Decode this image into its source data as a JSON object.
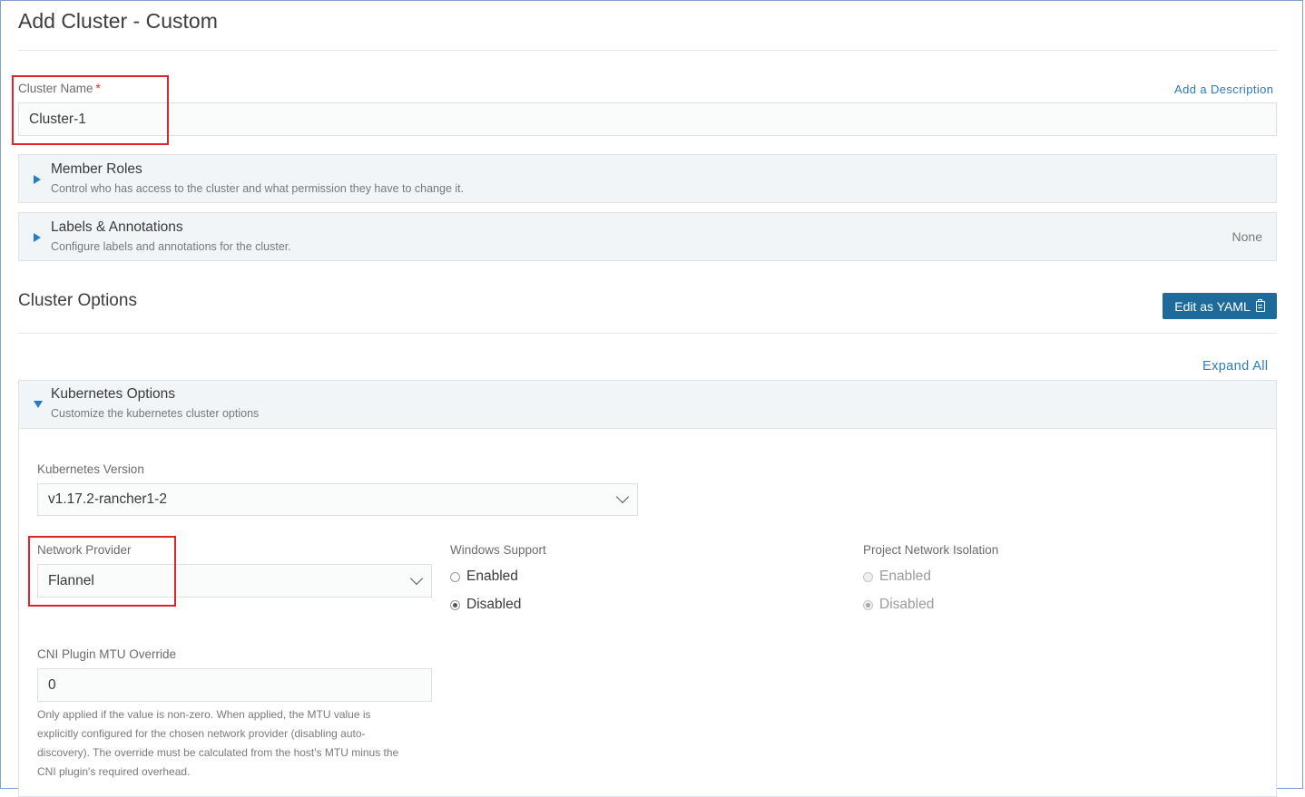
{
  "header": {
    "title": "Add Cluster - Custom"
  },
  "cluster_name": {
    "label": "Cluster Name",
    "required_marker": "*",
    "value": "Cluster-1",
    "add_description_link": "Add a Description"
  },
  "panels": {
    "member_roles": {
      "title": "Member Roles",
      "description": "Control who has access to the cluster and what permission they have to change it."
    },
    "labels": {
      "title": "Labels & Annotations",
      "description": "Configure labels and annotations for the cluster.",
      "status": "None"
    }
  },
  "cluster_options": {
    "title": "Cluster Options",
    "edit_yaml_button": "Edit as YAML",
    "expand_all_link": "Expand All"
  },
  "kubernetes_options": {
    "title": "Kubernetes Options",
    "description": "Customize the kubernetes cluster options",
    "version": {
      "label": "Kubernetes Version",
      "value": "v1.17.2-rancher1-2"
    },
    "network_provider": {
      "label": "Network Provider",
      "value": "Flannel"
    },
    "windows_support": {
      "label": "Windows Support",
      "options": [
        {
          "label": "Enabled",
          "selected": false
        },
        {
          "label": "Disabled",
          "selected": true
        }
      ]
    },
    "project_network_isolation": {
      "label": "Project Network Isolation",
      "options": [
        {
          "label": "Enabled",
          "selected": false
        },
        {
          "label": "Disabled",
          "selected": true
        }
      ],
      "disabled": true
    },
    "cni_mtu": {
      "label": "CNI Plugin MTU Override",
      "value": "0",
      "help_lines": [
        "Only applied if the value is non-zero. When applied, the MTU value is",
        "explicitly configured for the chosen network provider (disabling auto-",
        "discovery). The override must be calculated from the host's MTU minus the",
        "CNI plugin's required overhead."
      ]
    }
  },
  "colors": {
    "accent": "#2a7bbf",
    "button": "#1e6b9b",
    "highlight_box": "#e0242c",
    "required": "#d12c2c"
  }
}
